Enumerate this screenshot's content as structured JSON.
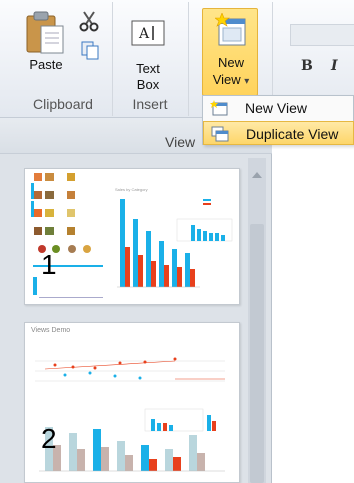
{
  "ribbon": {
    "clipboard": {
      "paste_label": "Paste",
      "group_label": "Clipboard"
    },
    "insert": {
      "textbox_label_line1": "Text",
      "textbox_label_line2": "Box",
      "group_label": "Insert"
    },
    "view": {
      "newview_label_line1": "New",
      "newview_label_line2": "View",
      "dropdown_arrow": "▾",
      "group_label": "View"
    },
    "format": {
      "bold": "B",
      "italic": "I"
    }
  },
  "menu": {
    "items": [
      {
        "label": "New View",
        "icon": "new-view-icon",
        "highlighted": false
      },
      {
        "label": "Duplicate View",
        "icon": "duplicate-view-icon",
        "highlighted": true
      }
    ]
  },
  "slides": [
    {
      "number": "1"
    },
    {
      "number": "2",
      "title": "Views Demo"
    }
  ],
  "colors": {
    "accent_blue": "#1ab0e8",
    "accent_red": "#e8401c",
    "highlight": "#ffd35c"
  }
}
